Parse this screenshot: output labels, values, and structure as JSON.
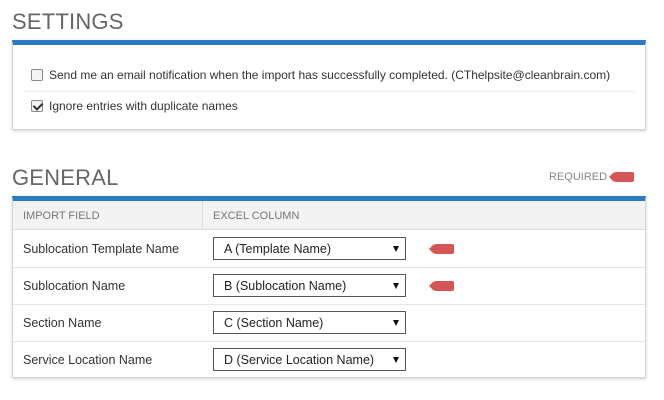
{
  "settings": {
    "title": "SETTINGS",
    "email_notification": {
      "label": "Send me an email notification when the import has successfully completed.  (CThelpsite@cleanbrain.com)",
      "checked": false
    },
    "ignore_duplicates": {
      "label": "Ignore entries with duplicate names",
      "checked": true
    }
  },
  "general": {
    "title": "GENERAL",
    "required_label": "REQUIRED",
    "required_color": "#d45555",
    "accent_color": "#2b7bc2",
    "columns": {
      "import_field": "IMPORT FIELD",
      "excel_column": "EXCEL COLUMN"
    },
    "rows": [
      {
        "field": "Sublocation Template Name",
        "column": "A (Template Name)",
        "required": true
      },
      {
        "field": "Sublocation Name",
        "column": "B (Sublocation Name)",
        "required": true
      },
      {
        "field": "Section Name",
        "column": "C (Section Name)",
        "required": false
      },
      {
        "field": "Service Location Name",
        "column": "D (Service Location Name)",
        "required": false
      }
    ]
  }
}
